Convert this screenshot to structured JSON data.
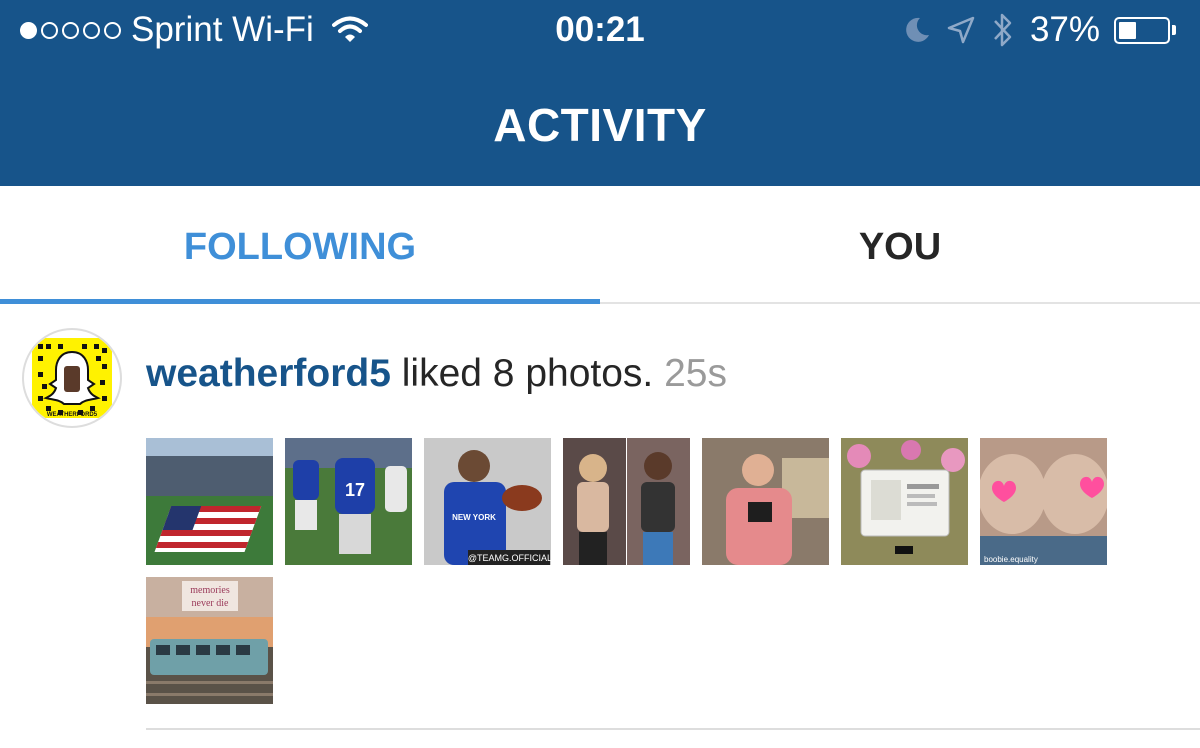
{
  "status_bar": {
    "carrier": "Sprint Wi-Fi",
    "signal_filled": 1,
    "signal_total": 5,
    "time": "00:21",
    "battery_percent": "37%",
    "battery_level": 0.37,
    "icons": [
      "wifi-icon",
      "moon-icon",
      "location-arrow-icon",
      "bluetooth-icon",
      "battery-icon"
    ]
  },
  "header": {
    "title": "ACTIVITY"
  },
  "tabs": [
    {
      "label": "FOLLOWING",
      "active": true
    },
    {
      "label": "YOU",
      "active": false
    }
  ],
  "feed": {
    "item": {
      "username": "weatherford5",
      "action": "liked 8 photos.",
      "time": "25s",
      "avatar_caption": "WEATHERFORD5",
      "photos": [
        {
          "name": "stadium-flag-photo"
        },
        {
          "name": "football-players-photo"
        },
        {
          "name": "player-with-football-photo",
          "caption": "@TEAMG.OFFICIAL",
          "jersey_text": "NEW YORK"
        },
        {
          "name": "two-women-photo"
        },
        {
          "name": "man-pink-shirt-photo"
        },
        {
          "name": "tablet-flowers-photo"
        },
        {
          "name": "hearts-photo",
          "caption": "boobie.equality"
        },
        {
          "name": "train-photo",
          "caption_line1": "memories",
          "caption_line2": "never die"
        }
      ]
    }
  },
  "colors": {
    "header_bg": "#17548a",
    "active_tab": "#3f8fd8",
    "username": "#17548a",
    "timestamp": "#9a9a9a"
  }
}
